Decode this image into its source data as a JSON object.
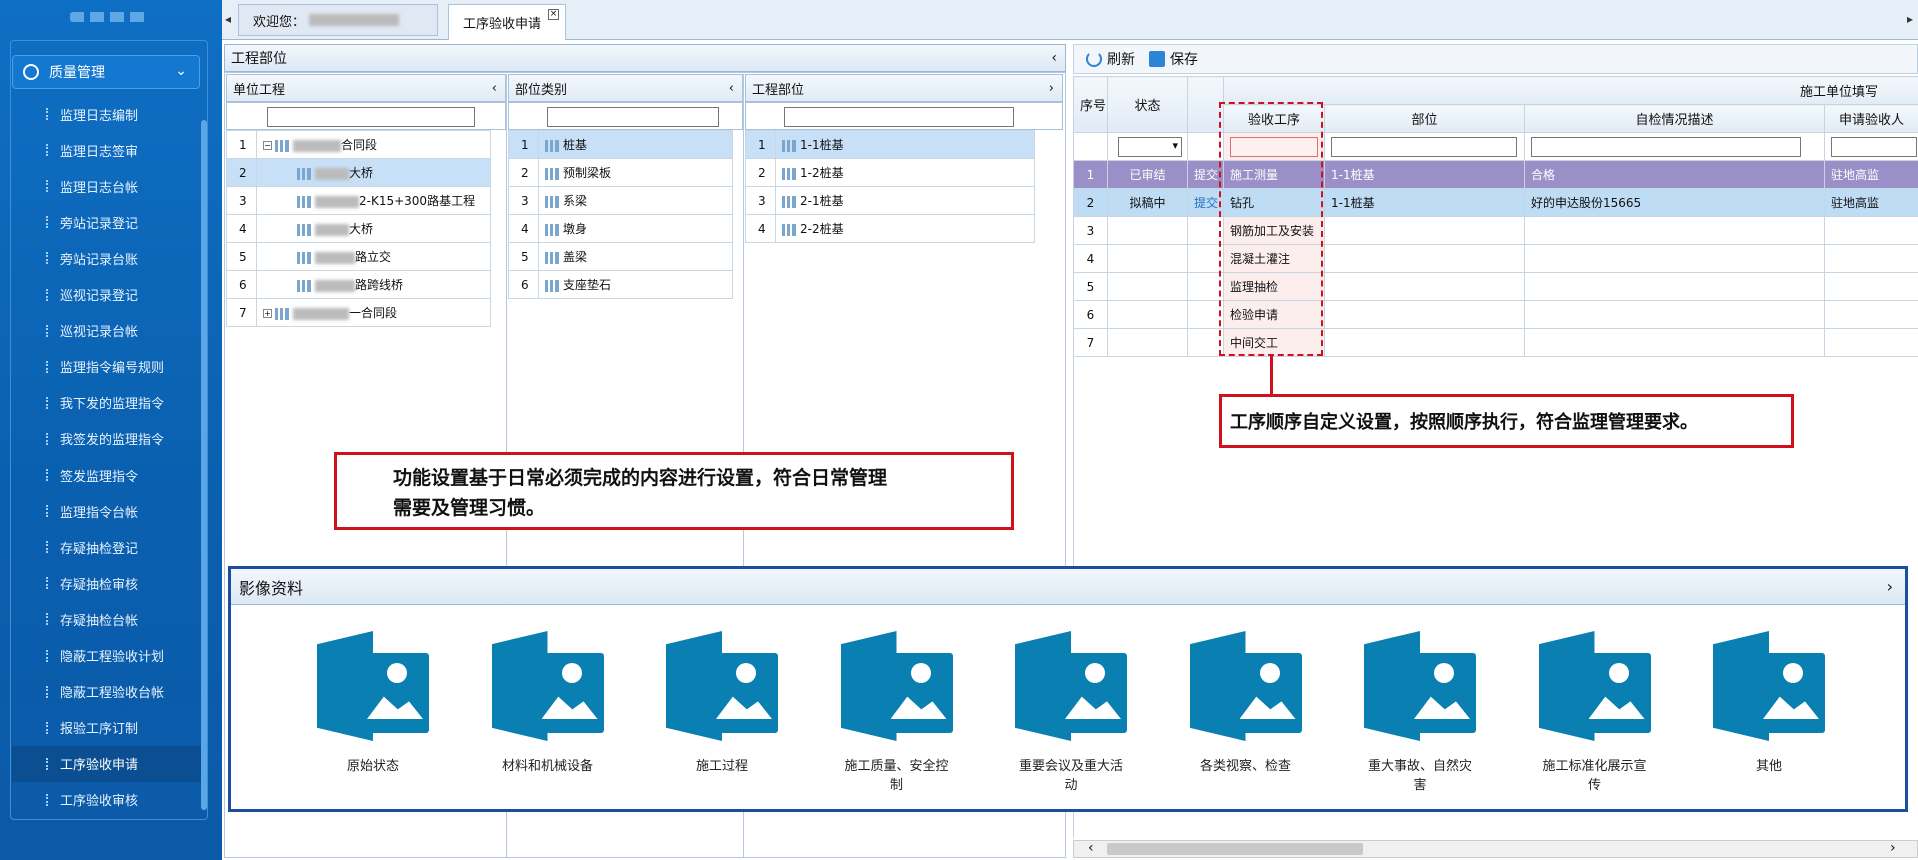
{
  "sidebar": {
    "section_title": "质量管理",
    "items": [
      {
        "label": "监理日志编制"
      },
      {
        "label": "监理日志签审"
      },
      {
        "label": "监理日志台帐"
      },
      {
        "label": "旁站记录登记"
      },
      {
        "label": "旁站记录台账"
      },
      {
        "label": "巡视记录登记"
      },
      {
        "label": "巡视记录台帐"
      },
      {
        "label": "监理指令编号规则"
      },
      {
        "label": "我下发的监理指令"
      },
      {
        "label": "我签发的监理指令"
      },
      {
        "label": "签发监理指令"
      },
      {
        "label": "监理指令台帐"
      },
      {
        "label": "存疑抽检登记"
      },
      {
        "label": "存疑抽检审核"
      },
      {
        "label": "存疑抽检台帐"
      },
      {
        "label": "隐蔽工程验收计划"
      },
      {
        "label": "隐蔽工程验收台帐"
      },
      {
        "label": "报验工序订制"
      },
      {
        "label": "工序验收申请",
        "active": true
      },
      {
        "label": "工序验收审核"
      }
    ]
  },
  "tabs": {
    "welcome": "欢迎您：",
    "active": "工序验收申请",
    "close_glyph": "×"
  },
  "left_panel": {
    "title": "工程部位",
    "unit": {
      "header": "单位工程",
      "rows": [
        {
          "n": "1",
          "label": "合同段",
          "tree": "⊟"
        },
        {
          "n": "2",
          "label": "大桥",
          "selected": true
        },
        {
          "n": "3",
          "label": "2-K15+300路基工程"
        },
        {
          "n": "4",
          "label": "大桥"
        },
        {
          "n": "5",
          "label": "路立交"
        },
        {
          "n": "6",
          "label": "路跨线桥"
        },
        {
          "n": "7",
          "label": "一合同段",
          "tree": "⊞"
        }
      ]
    },
    "category": {
      "header": "部位类别",
      "rows": [
        {
          "n": "1",
          "label": "桩基",
          "selected": true
        },
        {
          "n": "2",
          "label": "预制梁板"
        },
        {
          "n": "3",
          "label": "系梁"
        },
        {
          "n": "4",
          "label": "墩身"
        },
        {
          "n": "5",
          "label": "盖梁"
        },
        {
          "n": "6",
          "label": "支座垫石"
        }
      ]
    },
    "part": {
      "header": "工程部位",
      "rows": [
        {
          "n": "1",
          "label": "1-1桩基",
          "selected": true
        },
        {
          "n": "2",
          "label": "1-2桩基"
        },
        {
          "n": "3",
          "label": "2-1桩基"
        },
        {
          "n": "4",
          "label": "2-2桩基"
        }
      ]
    }
  },
  "toolbar": {
    "refresh": "刷新",
    "save": "保存"
  },
  "grid": {
    "group_header": "施工单位填写",
    "columns": {
      "seq": "序号",
      "status": "状态",
      "process": "验收工序",
      "part": "部位",
      "desc": "自检情况描述",
      "applicant": "申请验收人"
    },
    "rows": [
      {
        "n": "1",
        "status": "已审结",
        "action": "提交",
        "process": "施工测量",
        "part": "1-1桩基",
        "desc": "合格",
        "applicant": "驻地高监"
      },
      {
        "n": "2",
        "status": "拟稿中",
        "action": "提交",
        "process": "钻孔",
        "part": "1-1桩基",
        "desc": "好的申达股份15665",
        "applicant": "驻地高监"
      },
      {
        "n": "3",
        "status": "",
        "action": "",
        "process": "钢筋加工及安装",
        "part": "",
        "desc": "",
        "applicant": ""
      },
      {
        "n": "4",
        "status": "",
        "action": "",
        "process": "混凝土灌注",
        "part": "",
        "desc": "",
        "applicant": ""
      },
      {
        "n": "5",
        "status": "",
        "action": "",
        "process": "监理抽检",
        "part": "",
        "desc": "",
        "applicant": ""
      },
      {
        "n": "6",
        "status": "",
        "action": "",
        "process": "检验申请",
        "part": "",
        "desc": "",
        "applicant": ""
      },
      {
        "n": "7",
        "status": "",
        "action": "",
        "process": "中间交工",
        "part": "",
        "desc": "",
        "applicant": ""
      }
    ]
  },
  "callouts": {
    "process": "工序顺序自定义设置，按照顺序执行，符合监理管理要求。",
    "function_line1": "功能设置基于日常必须完成的内容进行设置，符合日常管理",
    "function_line2": "需要及管理习惯。"
  },
  "media": {
    "title": "影像资料",
    "items": [
      {
        "l1": "原始状态",
        "l2": ""
      },
      {
        "l1": "材料和机械设备",
        "l2": ""
      },
      {
        "l1": "施工过程",
        "l2": ""
      },
      {
        "l1": "施工质量、安全控",
        "l2": "制"
      },
      {
        "l1": "重要会议及重大活",
        "l2": "动"
      },
      {
        "l1": "各类视察、检查",
        "l2": ""
      },
      {
        "l1": "重大事故、自然灾",
        "l2": "害"
      },
      {
        "l1": "施工标准化展示宣",
        "l2": "传"
      },
      {
        "l1": "其他",
        "l2": ""
      }
    ]
  },
  "colors": {
    "accent": "#0b6fc2",
    "callout_border": "#d0101c",
    "approved_row": "#9b8fc7",
    "icon": "#0a7fb2"
  }
}
